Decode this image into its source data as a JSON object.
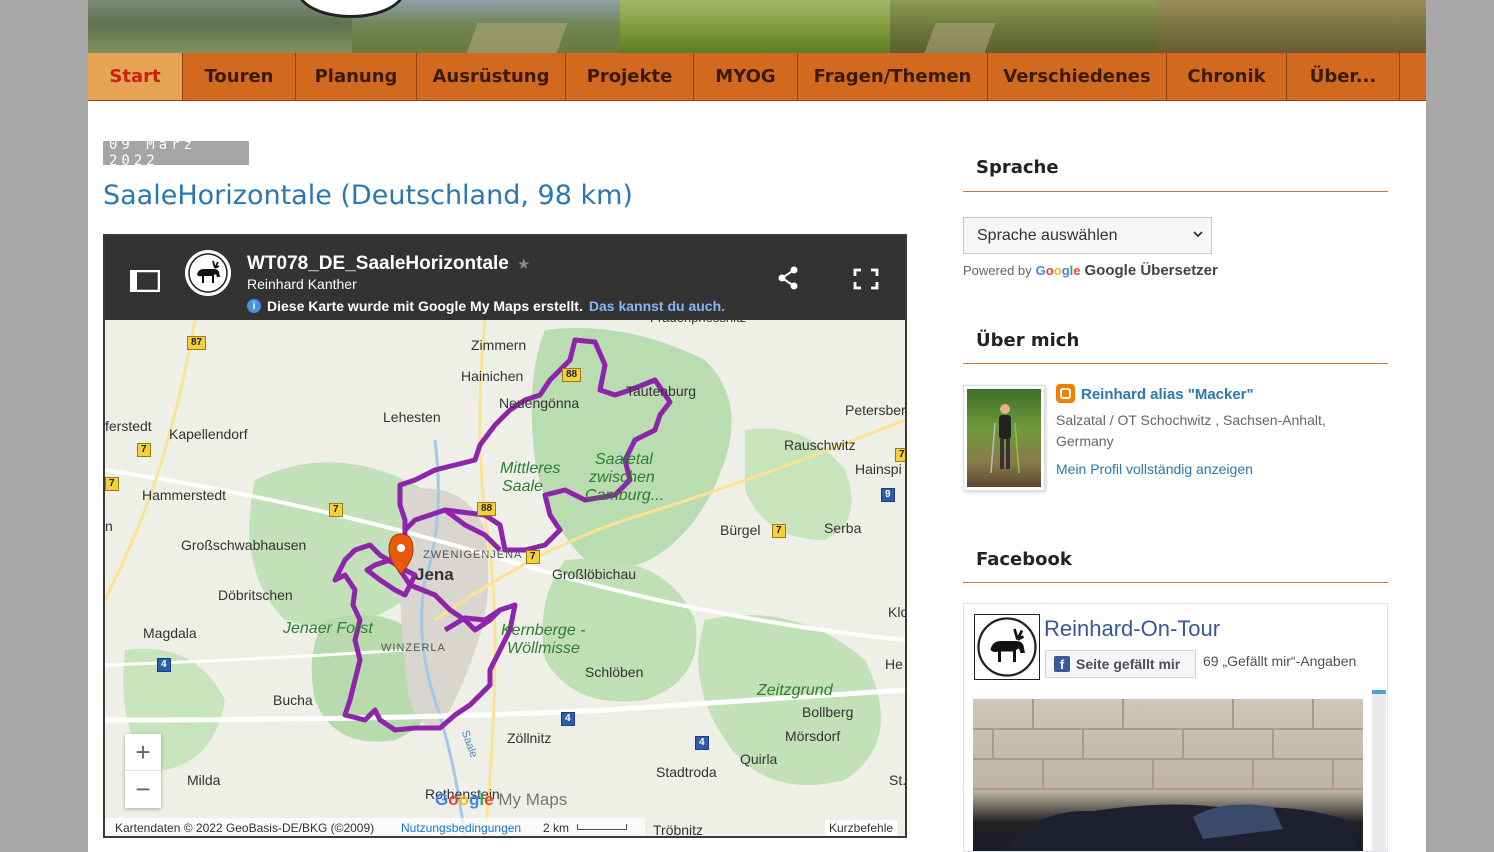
{
  "nav": {
    "items": [
      {
        "label": "Start",
        "active": true
      },
      {
        "label": "Touren"
      },
      {
        "label": "Planung"
      },
      {
        "label": "Ausrüstung"
      },
      {
        "label": "Projekte"
      },
      {
        "label": "MYOG"
      },
      {
        "label": "Fragen/Themen"
      },
      {
        "label": "Verschiedenes"
      },
      {
        "label": "Chronik"
      },
      {
        "label": "Über..."
      }
    ]
  },
  "post": {
    "date": "09 März 2022",
    "title": "SaaleHorizontale (Deutschland, 98 km)"
  },
  "map": {
    "title": "WT078_DE_SaaleHorizontale",
    "author": "Reinhard Kanther",
    "info_text": "Diese Karte wurde mit Google My Maps erstellt.",
    "info_link": "Das kannst du auch.",
    "zoom_in": "+",
    "zoom_out": "−",
    "brand_google": [
      "G",
      "o",
      "o",
      "g",
      "l",
      "e"
    ],
    "brand_mymaps": "My Maps",
    "copyright": "Kartendaten © 2022 GeoBasis-DE/BKG (©2009)",
    "terms": "Nutzungsbedingungen",
    "scale": "2 km",
    "shortcuts": "Kurzbefehle",
    "labels": {
      "zimmern": "Zimmern",
      "hainichen": "Hainichen",
      "neuengonna": "Neuengönna",
      "tautenburg": "Tautenburg",
      "petersberg": "Petersberg",
      "lehesten": "Lehesten",
      "rauschwitz": "Rauschwitz",
      "ferstedt": "ferstedt",
      "kapellendorf": "Kapellendorf",
      "hainspitz": "Hainspi",
      "hammerstedt": "Hammerstedt",
      "park1": "Mittleres",
      "park2": "Saaletal",
      "park3": "Saale",
      "park4": "zwischen",
      "park5": "Camburg...",
      "buergel": "Bürgel",
      "serba": "Serba",
      "grossschwabhausen": "Großschwabhausen",
      "zwenigenjena": "ZWENIGENJENA",
      "jena": "Jena",
      "grossloebichau": "Großlöbichau",
      "doebritschen": "Döbritschen",
      "magdala": "Magdala",
      "jenaer_forst": "Jenaer Forst",
      "kernberge": "Kernberge -",
      "woellmisse": "Wöllmisse",
      "klo": "Klo",
      "winzerla": "WINZERLA",
      "schloeben": "Schlöben",
      "he": "He",
      "zeitzgrund": "Zeitzgrund",
      "bucha": "Bucha",
      "bollberg": "Bollberg",
      "zoellnitz": "Zöllnitz",
      "moersdorf": "Mörsdorf",
      "saale_river": "Saale",
      "milda": "Milda",
      "stadtroda": "Stadtroda",
      "quirla": "Quirla",
      "st": "St.",
      "rothenstein": "Rothenstein",
      "troebnitz": "Tröbnitz",
      "froehlichswiese": "Frauenpriessnitz",
      "n_edge": "n"
    },
    "shields": {
      "s87": "87",
      "s88a": "88",
      "s88b": "88",
      "s7a": "7",
      "s7b": "7",
      "s7c": "7",
      "s7d": "7",
      "s7e": "7",
      "s7f": "7",
      "s9": "9",
      "s4a": "4",
      "s4b": "4",
      "s4c": "4"
    }
  },
  "sidebar": {
    "language": {
      "heading": "Sprache",
      "select_value": "Sprache auswählen",
      "powered_by": "Powered by",
      "google": "Google",
      "translator": "Google Übersetzer"
    },
    "about": {
      "heading": "Über mich",
      "name": "Reinhard alias \"Macker\"",
      "location": "Salzatal / OT Schochwitz , Sachsen-Anhalt, Germany",
      "profile_link": "Mein Profil vollständig anzeigen"
    },
    "facebook": {
      "heading": "Facebook",
      "page_name": "Reinhard-On-Tour",
      "like_button": "Seite gefällt mir",
      "likes": "69 „Gefällt mir“-Angaben",
      "fb_letter": "f"
    }
  },
  "colors": {
    "nav_bg": "#d2691e",
    "nav_active_bg": "#e6a354",
    "nav_active_text": "#d01f10",
    "title_blue": "#2a78b3",
    "route_purple": "#8e24aa",
    "marker_orange": "#e8590c",
    "rule_orange": "#c8783a"
  }
}
